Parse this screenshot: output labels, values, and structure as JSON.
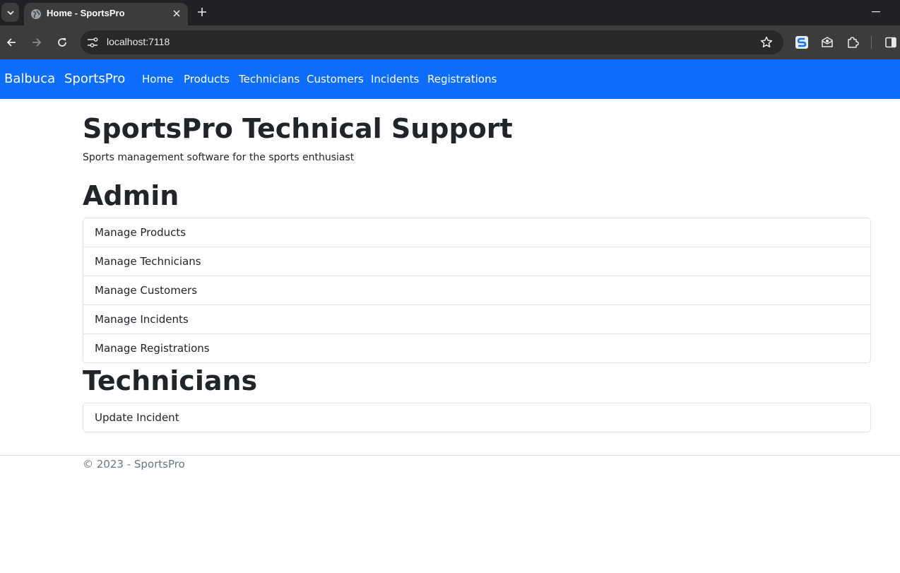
{
  "browser": {
    "tab_title": "Home - SportsPro",
    "url": "localhost:7118"
  },
  "navbar": {
    "brand_primary": "Balbuca",
    "brand_secondary": "SportsPro",
    "links": [
      "Home",
      "Products",
      "Technicians",
      "Customers",
      "Incidents",
      "Registrations"
    ]
  },
  "main": {
    "title": "SportsPro Technical Support",
    "lead": "Sports management software for the sports enthusiast",
    "admin": {
      "heading": "Admin",
      "items": [
        "Manage Products",
        "Manage Technicians",
        "Manage Customers",
        "Manage Incidents",
        "Manage Registrations"
      ]
    },
    "technicians": {
      "heading": "Technicians",
      "items": [
        "Update Incident"
      ]
    }
  },
  "footer": {
    "text": "© 2023 - SportsPro"
  },
  "colors": {
    "navbar_bg": "#0d6efd",
    "tabstrip_bg": "#202124",
    "toolbar_bg": "#3c3c3c"
  }
}
